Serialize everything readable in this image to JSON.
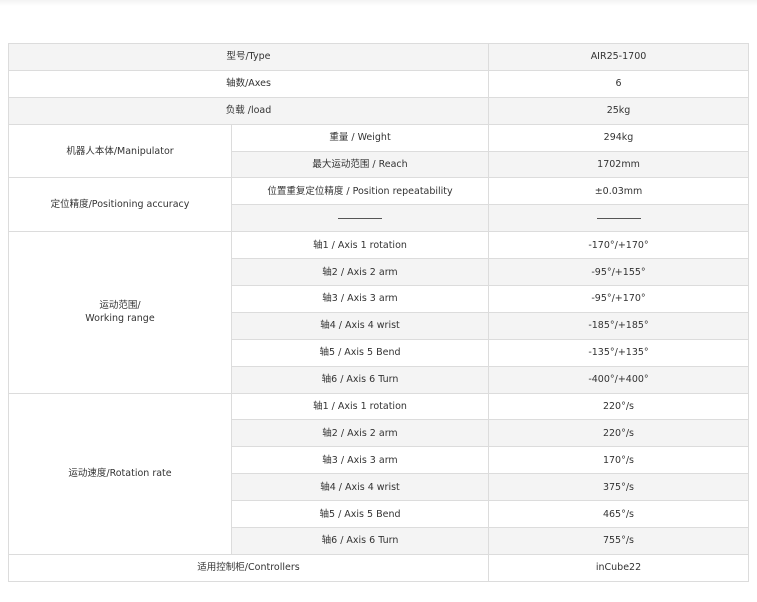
{
  "rows": [
    {
      "label": "型号/Type",
      "value": "AIR25-1700"
    },
    {
      "label": "轴数/Axes",
      "value": "6"
    },
    {
      "label": "负载 /load",
      "value": "25kg"
    }
  ],
  "manipulator": {
    "group": "机器人本体/Manipulator",
    "items": [
      {
        "label": "重量 / Weight",
        "value": "294kg"
      },
      {
        "label": "最大运动范围 / Reach",
        "value": "1702mm"
      }
    ]
  },
  "positioning": {
    "group": "定位精度/Positioning accuracy",
    "items": [
      {
        "label": "位置重复定位精度 / Position repeatability",
        "value": "±0.03mm"
      }
    ]
  },
  "working_range": {
    "group_line1": "运动范围/",
    "group_line2": "Working range",
    "items": [
      {
        "label": "轴1 / Axis 1 rotation",
        "value": "-170°/+170°"
      },
      {
        "label": "轴2 / Axis 2 arm",
        "value": "-95°/+155°"
      },
      {
        "label": "轴3 / Axis 3 arm",
        "value": "-95°/+170°"
      },
      {
        "label": "轴4 / Axis 4 wrist",
        "value": "-185°/+185°"
      },
      {
        "label": "轴5 / Axis 5 Bend",
        "value": "-135°/+135°"
      },
      {
        "label": "轴6 / Axis 6 Turn",
        "value": "-400°/+400°"
      }
    ]
  },
  "rotation_rate": {
    "group": "运动速度/Rotation rate",
    "items": [
      {
        "label": "轴1 / Axis 1 rotation",
        "value": "220°/s"
      },
      {
        "label": "轴2 / Axis 2 arm",
        "value": "220°/s"
      },
      {
        "label": "轴3 / Axis 3 arm",
        "value": "170°/s"
      },
      {
        "label": "轴4 / Axis 4 wrist",
        "value": "375°/s"
      },
      {
        "label": "轴5 / Axis 5 Bend",
        "value": "465°/s"
      },
      {
        "label": "轴6 / Axis 6 Turn",
        "value": "755°/s"
      }
    ]
  },
  "controllers": {
    "label": "适用控制柜/Controllers",
    "value": "inCube22"
  }
}
